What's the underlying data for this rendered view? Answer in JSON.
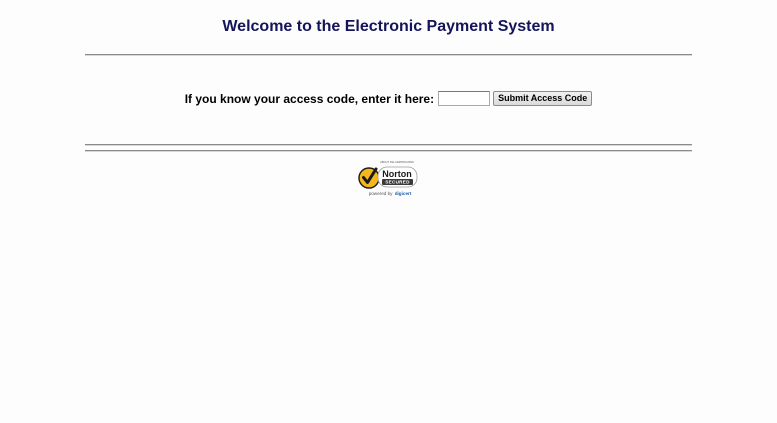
{
  "page": {
    "title": "Welcome to the Electronic Payment System"
  },
  "access": {
    "label": "If you know your access code, enter it here:",
    "input_value": "",
    "input_placeholder": "",
    "submit_label": "Submit Access Code"
  },
  "norton_badge": {
    "icon": "norton-secured-seal-icon",
    "top_text": "ABOUT SSL CERTIFICATES",
    "brand": "Norton",
    "secured": "SECURED",
    "powered_by": "powered by",
    "provider": "digicert",
    "colors": {
      "check_yellow": "#f5b81c",
      "check_dark": "#1a1a1a",
      "digicert_blue": "#1d5ea8"
    }
  }
}
